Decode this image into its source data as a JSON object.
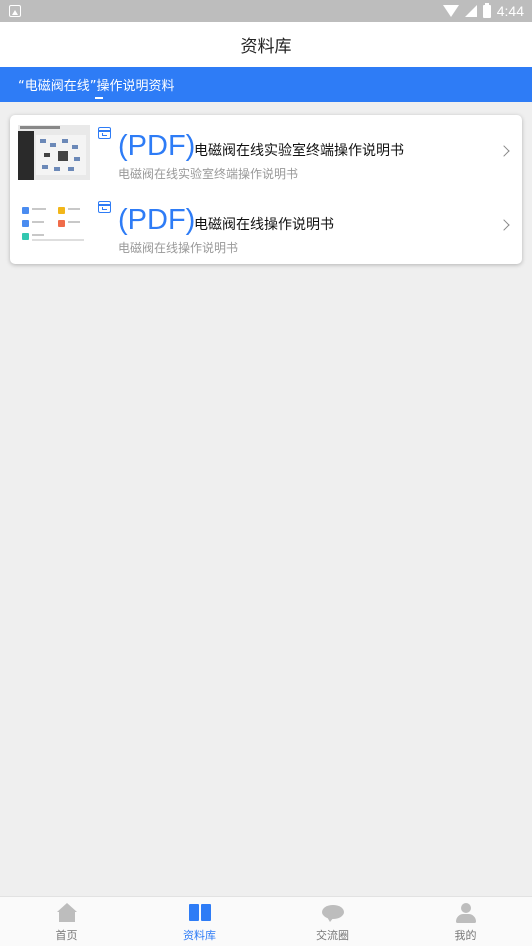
{
  "status_bar": {
    "time": "4:44"
  },
  "header": {
    "title": "资料库"
  },
  "tab_strip": {
    "tab_label": "“电磁阀在线”操作说明资料"
  },
  "documents": [
    {
      "tag": "(PDF)",
      "title": "电磁阀在线实验室终端操作说明书",
      "subtitle": "电磁阀在线实验室终端操作说明书"
    },
    {
      "tag": "(PDF)",
      "title": "电磁阀在线操作说明书",
      "subtitle": "电磁阀在线操作说明书"
    }
  ],
  "bottom_nav": [
    {
      "label": "首页",
      "icon": "home-icon",
      "active": false
    },
    {
      "label": "资料库",
      "icon": "book-icon",
      "active": true
    },
    {
      "label": "交流圈",
      "icon": "chat-icon",
      "active": false
    },
    {
      "label": "我的",
      "icon": "user-icon",
      "active": false
    }
  ],
  "colors": {
    "accent": "#2e7cf6",
    "background": "#efefef",
    "status_bar": "#bdbdbd",
    "inactive": "#777777"
  }
}
